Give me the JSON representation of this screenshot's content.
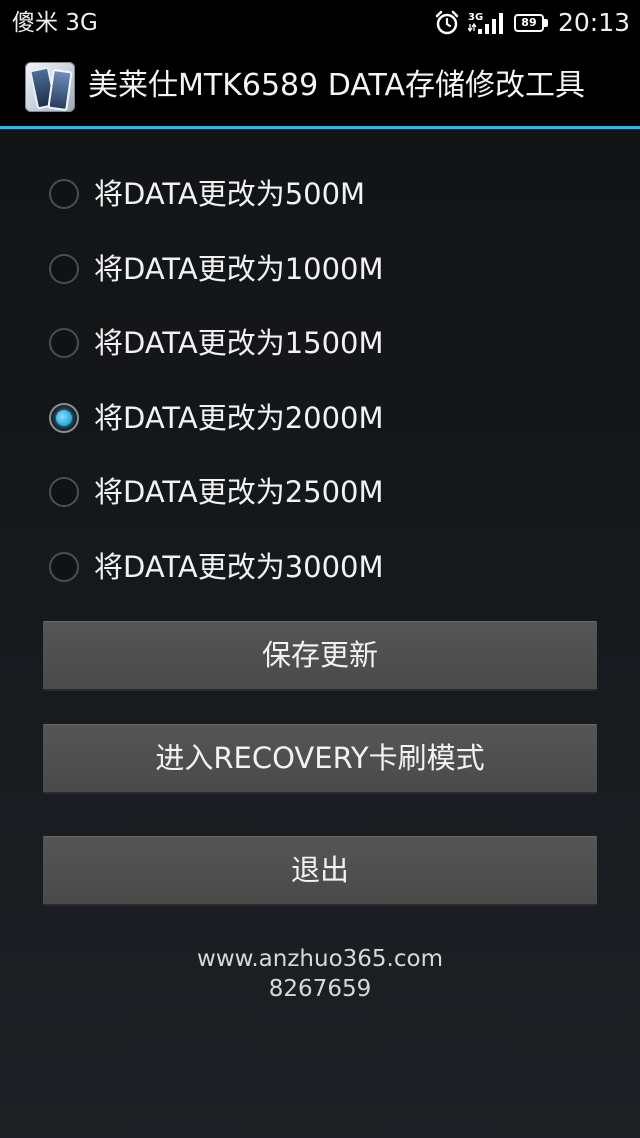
{
  "status_bar": {
    "carrier": "傻米 3G",
    "network": "3G",
    "battery_level": "89",
    "time": "20:13",
    "icons": [
      "alarm-icon",
      "signal-icon",
      "battery-icon"
    ]
  },
  "action_bar": {
    "title": "美莱仕MTK6589 DATA存储修改工具",
    "app_icon": "app-icon",
    "divider_color": "#33b5e5"
  },
  "options": {
    "selected_index": 3,
    "items": [
      {
        "label": "将DATA更改为500M",
        "checked": false
      },
      {
        "label": "将DATA更改为1000M",
        "checked": false
      },
      {
        "label": "将DATA更改为1500M",
        "checked": false
      },
      {
        "label": "将DATA更改为2000M",
        "checked": true
      },
      {
        "label": "将DATA更改为2500M",
        "checked": false
      },
      {
        "label": "将DATA更改为3000M",
        "checked": false
      }
    ]
  },
  "buttons": {
    "save": "保存更新",
    "recovery": "进入RECOVERY卡刷模式",
    "exit": "退出"
  },
  "footer": {
    "url": "www.anzhuo365.com",
    "code": "8267659"
  },
  "colors": {
    "accent": "#33b5e5",
    "button": "#505050",
    "background": "#15181b"
  }
}
